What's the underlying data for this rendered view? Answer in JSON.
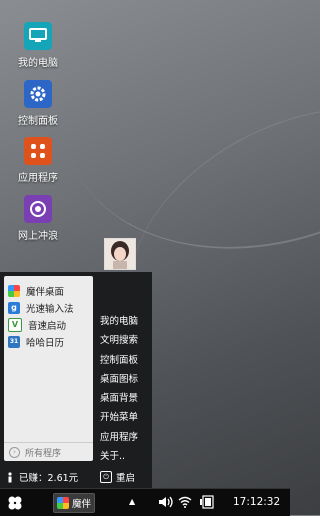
{
  "desktop": {
    "icons": [
      {
        "label": "我的电脑",
        "icon": "computer-icon",
        "color": "#14a5b8"
      },
      {
        "label": "控制面板",
        "icon": "gear-icon",
        "color": "#2c67c8"
      },
      {
        "label": "应用程序",
        "icon": "apps-icon",
        "color": "#e0521c"
      },
      {
        "label": "网上冲浪",
        "icon": "browser-icon",
        "color": "#7a3fb2"
      }
    ]
  },
  "start_menu": {
    "apps": [
      {
        "label": "魔伴桌面",
        "icon": "mobanzhuomian-icon",
        "color": "#4db8e8"
      },
      {
        "label": "光速输入法",
        "icon": "input-method-icon",
        "color": "#2b7bd8",
        "glyph": "g"
      },
      {
        "label": "音速启动",
        "icon": "launcher-icon",
        "color": "#3a9a3a",
        "glyph": "V"
      },
      {
        "label": "哈哈日历",
        "icon": "calendar-icon",
        "color": "#2f76c2",
        "glyph": "31"
      }
    ],
    "all_programs": "所有程序",
    "right_items": [
      "我的电脑",
      "文明搜索",
      "控制面板",
      "桌面图标",
      "桌面背景",
      "开始菜单",
      "应用程序",
      "关于.."
    ],
    "earned": "已赚：2.61元",
    "restart": "重启"
  },
  "taskbar": {
    "task_label": "魔伴",
    "clock": "17:12:32"
  }
}
